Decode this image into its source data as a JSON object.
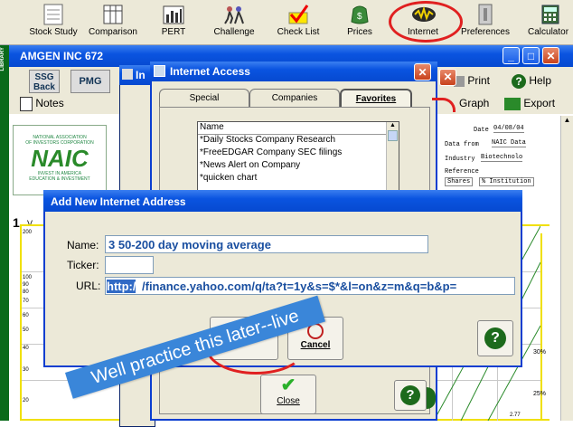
{
  "toolbar": {
    "items": [
      {
        "label": "Stock Study",
        "icon": "stock-study-icon"
      },
      {
        "label": "Comparison",
        "icon": "comparison-icon"
      },
      {
        "label": "PERT",
        "icon": "pert-icon"
      },
      {
        "label": "Challenge",
        "icon": "challenge-icon"
      },
      {
        "label": "Check List",
        "icon": "check-list-icon"
      },
      {
        "label": "Prices",
        "icon": "prices-icon"
      },
      {
        "label": "Internet",
        "icon": "internet-icon"
      },
      {
        "label": "Preferences",
        "icon": "preferences-icon"
      },
      {
        "label": "Calculator",
        "icon": "calculator-icon"
      }
    ],
    "highlight_color": "#e02020"
  },
  "main_window": {
    "title": "AMGEN INC 672",
    "side_label": "LIBRARY",
    "buttons": {
      "ssg_back": "SSG Back",
      "pmg": "PMG",
      "print": "Print",
      "help": "Help",
      "notes": "Notes",
      "graph": "Graph",
      "export": "Export"
    },
    "form": {
      "date_label": "Date",
      "date_value": "04/08/04",
      "data_from_label": "Data from",
      "data_from_value": "NAIC Data",
      "industry_label": "Industry",
      "industry_value": "Biotechnolo",
      "reference_label": "Reference",
      "shares_label": "Shares",
      "institution_label": "% Institution"
    },
    "naic_lines": [
      "NATIONAL ASSOCIATION",
      "OF INVESTORS CORPORATION"
    ],
    "naic_logo": "NAIC",
    "naic_small": [
      "INVEST IN AMERICA",
      "EDUCATION & INVESTMENT"
    ],
    "section_number": "1",
    "section_letter": "V",
    "y_labels": [
      "200",
      "100",
      "90",
      "80",
      "70",
      "60",
      "50",
      "40",
      "30",
      "20"
    ],
    "right_labels": [
      "30%",
      "25%"
    ],
    "bottom_value": "2.77"
  },
  "internet_dialog_small": {
    "title": "In"
  },
  "internet_dialog": {
    "title": "Internet Access",
    "tabs": [
      "Special",
      "Companies",
      "Favorites"
    ],
    "list_header": "Name",
    "list_items": [
      "*Daily Stocks Company Research",
      "*FreeEDGAR Company SEC filings",
      "*News Alert on Company",
      "*quicken chart"
    ],
    "close_label": "Close"
  },
  "add_dialog": {
    "title": "Add New Internet Address",
    "name_label": "Name:",
    "name_value": "3 50-200 day moving average",
    "ticker_label": "Ticker:",
    "ticker_value": "",
    "url_label": "URL:",
    "url_selected": "http:/",
    "url_rest": "/finance.yahoo.com/q/ta?t=1y&s=$*&l=on&z=m&q=b&p=",
    "cancel_label": "Cancel"
  },
  "banner": {
    "text": "Well practice this later--live",
    "color": "#3a86d9"
  }
}
